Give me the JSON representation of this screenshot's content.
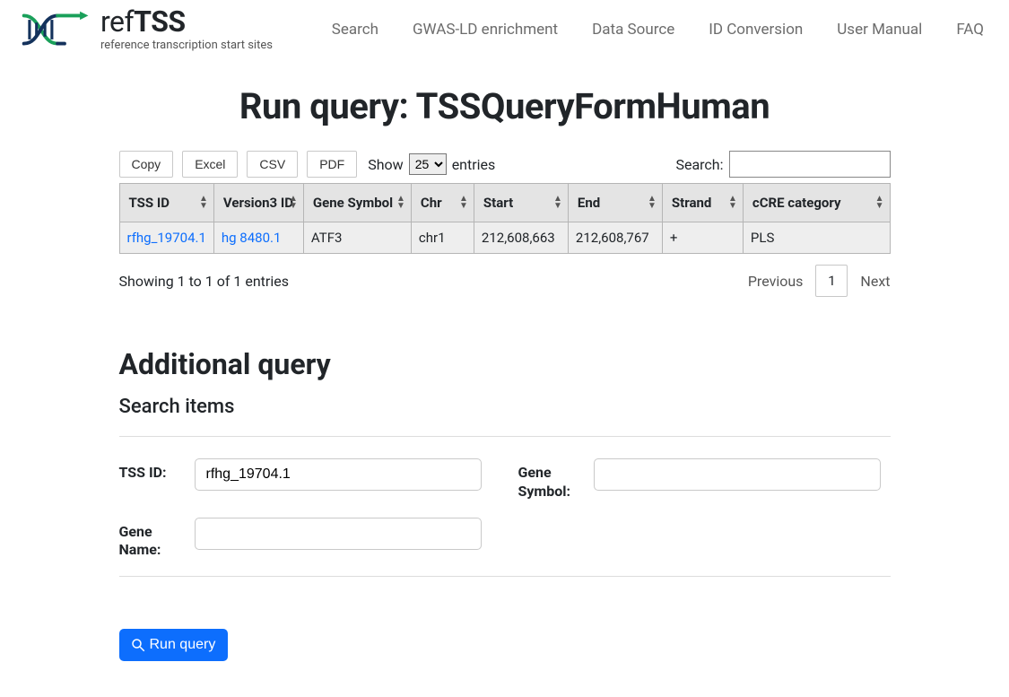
{
  "brand": {
    "title_ref": "ref",
    "title_tss": "TSS",
    "subtitle": "reference transcription start sites"
  },
  "nav": [
    "Search",
    "GWAS-LD enrichment",
    "Data Source",
    "ID Conversion",
    "User Manual",
    "FAQ"
  ],
  "page": {
    "title": "Run query: TSSQueryFormHuman"
  },
  "export_buttons": [
    "Copy",
    "Excel",
    "CSV",
    "PDF"
  ],
  "length_menu": {
    "prefix": "Show",
    "selected": "25",
    "options": [
      "25"
    ],
    "suffix": "entries"
  },
  "search": {
    "label": "Search:",
    "value": ""
  },
  "table": {
    "headers": [
      "TSS ID",
      "Version3 ID",
      "Gene Symbol",
      "Chr",
      "Start",
      "End",
      "Strand",
      "cCRE category"
    ],
    "rows": [
      {
        "tss_id": "rfhg_19704.1",
        "version3_id": "hg 8480.1",
        "gene_symbol": "ATF3",
        "chr": "chr1",
        "start": "212,608,663",
        "end": "212,608,767",
        "strand": "+",
        "ccre": "PLS"
      }
    ],
    "info": "Showing 1 to 1 of 1 entries",
    "paginate": {
      "previous": "Previous",
      "current": "1",
      "next": "Next"
    }
  },
  "additional": {
    "heading": "Additional query",
    "subheading": "Search items",
    "fields": {
      "tss_id": {
        "label": "TSS ID:",
        "value": "rfhg_19704.1"
      },
      "gene_symbol": {
        "label": "Gene Symbol:",
        "value": ""
      },
      "gene_name": {
        "label": "Gene Name:",
        "value": ""
      }
    },
    "run_button": "Run query"
  }
}
